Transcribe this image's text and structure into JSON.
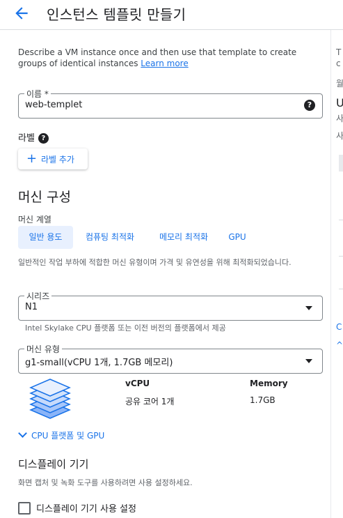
{
  "header": {
    "title": "인스턴스 템플릿 만들기"
  },
  "description": {
    "text": "Describe a VM instance once and then use that template to create groups of identical instances",
    "learn_more": "Learn more"
  },
  "name_field": {
    "label": "이름 *",
    "value": "web-templet",
    "help": "?"
  },
  "labels": {
    "title": "라벨",
    "help": "?",
    "add_button": "라벨 추가"
  },
  "machine_config": {
    "title": "머신 구성",
    "family_label": "머신 계열",
    "tabs": [
      {
        "label": "일반 용도",
        "active": true
      },
      {
        "label": "컴퓨팅 최적화",
        "active": false
      },
      {
        "label": "메모리 최적화",
        "active": false
      },
      {
        "label": "GPU",
        "active": false
      }
    ],
    "tab_description": "일반적인 작업 부하에 적합한 머신 유형이며 가격 및 유연성을 위해 최적화되었습니다.",
    "series": {
      "label": "시리즈",
      "value": "N1",
      "hint": "Intel Skylake CPU 플랫폼 또는 이전 버전의 플랫폼에서 제공"
    },
    "machine_type": {
      "label": "머신 유형",
      "value": "g1-small(vCPU 1개, 1.7GB 메모리)"
    },
    "specs": {
      "vcpu_header": "vCPU",
      "memory_header": "Memory",
      "vcpu_value": "공유 코어 1개",
      "memory_value": "1.7GB"
    },
    "cpu_platform_toggle": "CPU 플랫폼 및 GPU"
  },
  "display_device": {
    "title": "디스플레이 기기",
    "description": "화면 캡처 및 녹화 도구를 사용하려면 사용 설정하세요.",
    "checkbox_label": "디스플레이 기기 사용 설정",
    "checked": false
  },
  "right_panel_fragments": [
    "T",
    "c",
    "월",
    "U",
    "사",
    "사",
    "C",
    "^"
  ],
  "colors": {
    "accent": "#1a73e8",
    "tab_active_bg": "#e8f0fe",
    "stack_icon": "#1a73e8"
  }
}
